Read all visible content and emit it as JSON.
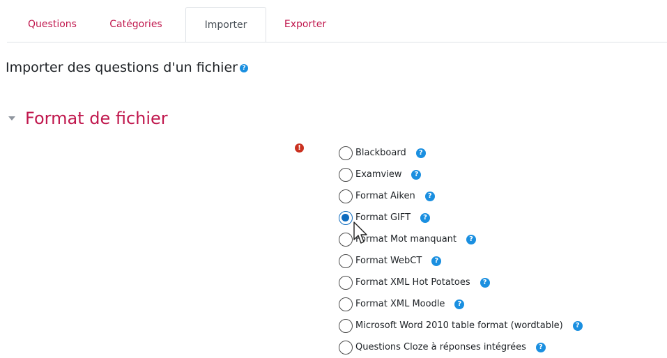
{
  "tabs": [
    {
      "label": "Questions",
      "active": false
    },
    {
      "label": "Catégories",
      "active": false
    },
    {
      "label": "Importer",
      "active": true
    },
    {
      "label": "Exporter",
      "active": false
    }
  ],
  "page": {
    "heading": "Importer des questions d'un fichier",
    "help_icon": "?"
  },
  "section": {
    "title": "Format de fichier",
    "required_icon": "!"
  },
  "formats": [
    {
      "label": "Blackboard",
      "checked": false
    },
    {
      "label": "Examview",
      "checked": false
    },
    {
      "label": "Format Aiken",
      "checked": false
    },
    {
      "label": "Format GIFT",
      "checked": true
    },
    {
      "label": "Format Mot manquant",
      "checked": false
    },
    {
      "label": "Format WebCT",
      "checked": false
    },
    {
      "label": "Format XML Hot Potatoes",
      "checked": false
    },
    {
      "label": "Format XML Moodle",
      "checked": false
    },
    {
      "label": "Microsoft Word 2010 table format (wordtable)",
      "checked": false
    },
    {
      "label": "Questions Cloze à réponses intégrées",
      "checked": false
    }
  ],
  "colors": {
    "accent": "#c0174d",
    "help": "#1a8fe0",
    "required": "#ca3120",
    "radio_checked": "#0f6cbf"
  }
}
